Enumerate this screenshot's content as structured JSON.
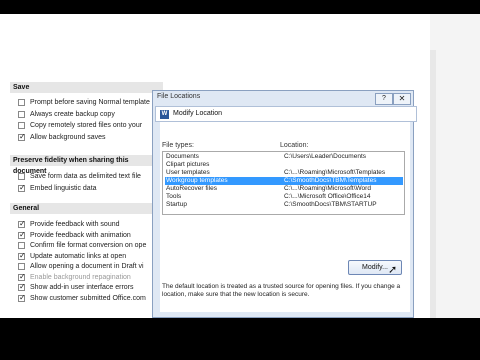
{
  "save_section": {
    "title": "Save",
    "options": [
      {
        "label": "Prompt before saving Normal template",
        "checked": false
      },
      {
        "label": "Always create backup copy",
        "checked": false
      },
      {
        "label": "Copy remotely stored files onto your",
        "checked": false
      },
      {
        "label": "Allow background saves",
        "checked": true
      }
    ]
  },
  "fidelity_section": {
    "title": "Preserve fidelity when sharing this document",
    "options": [
      {
        "label": "Save form data as delimited text file",
        "checked": false
      },
      {
        "label": "Embed linguistic data",
        "checked": true
      }
    ]
  },
  "general_section": {
    "title": "General",
    "options": [
      {
        "label": "Provide feedback with sound",
        "checked": true
      },
      {
        "label": "Provide feedback with animation",
        "checked": true
      },
      {
        "label": "Confirm file format conversion on ope",
        "checked": false
      },
      {
        "label": "Update automatic links at open",
        "checked": true
      },
      {
        "label": "Allow opening a document in Draft vi",
        "checked": false
      },
      {
        "label": "Enable background repagination",
        "checked": true,
        "dim": true
      },
      {
        "label": "Show add-in user interface errors",
        "checked": true
      },
      {
        "label": "Show customer submitted Office.com",
        "checked": true
      }
    ]
  },
  "file_locations": {
    "title": "File Locations",
    "help": "?",
    "close": "✕"
  },
  "modify_location": {
    "title": "Modify Location",
    "icon": "W",
    "col_file_types": "File types:",
    "col_location": "Location:",
    "rows": [
      {
        "type": "Documents",
        "location": "C:\\Users\\Leader\\Documents",
        "selected": false
      },
      {
        "type": "Clipart pictures",
        "location": "",
        "selected": false
      },
      {
        "type": "User templates",
        "location": "C:\\...\\Roaming\\Microsoft\\Templates",
        "selected": false
      },
      {
        "type": "Workgroup templates",
        "location": "C:\\SmoothDocs\\TBM\\Templates",
        "selected": true
      },
      {
        "type": "AutoRecover files",
        "location": "C:\\...\\Roaming\\Microsoft\\Word",
        "selected": false
      },
      {
        "type": "Tools",
        "location": "C:\\...\\Microsoft Office\\Office14",
        "selected": false
      },
      {
        "type": "Startup",
        "location": "C:\\SmoothDocs\\TBM\\STARTUP",
        "selected": false
      }
    ],
    "modify_label": "Modify...",
    "note": "The default location is treated as a trusted source for opening files. If you change a location, make sure that the new location is secure."
  }
}
